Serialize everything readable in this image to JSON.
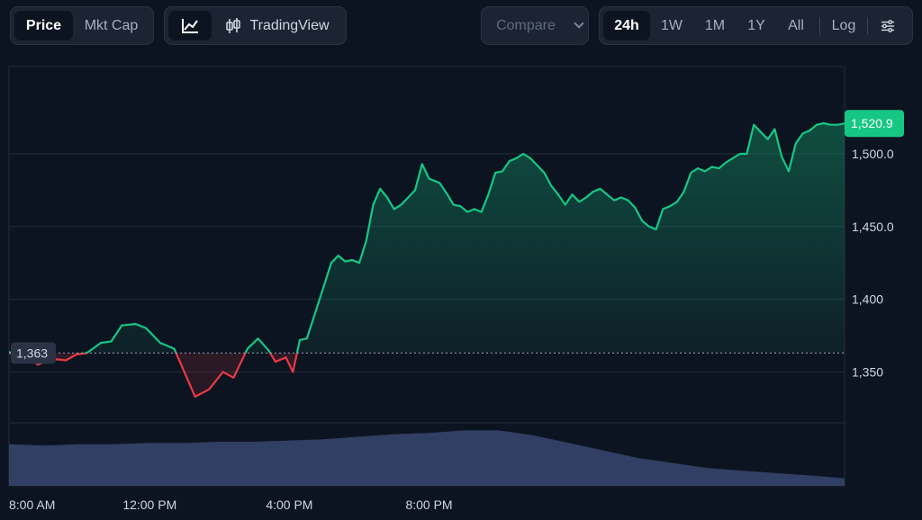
{
  "toolbar": {
    "metric_tabs": [
      "Price",
      "Mkt Cap"
    ],
    "active_metric": "Price",
    "tradingview_label": "TradingView",
    "compare_label": "Compare",
    "ranges": [
      "24h",
      "1W",
      "1M",
      "1Y",
      "All"
    ],
    "active_range": "24h",
    "log_label": "Log"
  },
  "colors": {
    "up": "#16c784",
    "down": "#ea3943",
    "volume": "#3a4670",
    "grid": "#222b3b",
    "background": "#0d1421",
    "price_badge": "#16c784"
  },
  "icons": [
    "line-chart-icon",
    "candlestick-icon",
    "chevron-down-icon",
    "settings-sliders-icon"
  ],
  "chart_data": {
    "type": "area",
    "baseline": 1363,
    "baseline_label": "1,363",
    "last_price_label": "1,520.9",
    "last_price": 1520.9,
    "ylim": [
      1315,
      1560
    ],
    "y_ticks": [
      1350,
      1400,
      1450,
      1500
    ],
    "y_tick_labels": [
      "1,350",
      "1,400",
      "1,450.0",
      "1,500.0"
    ],
    "x_tick_labels": [
      "8:00 AM",
      "12:00 PM",
      "4:00 PM",
      "8:00 PM"
    ],
    "x_tick_hours": [
      8,
      12,
      16,
      20
    ],
    "x_range_hours": [
      7.97,
      31.9
    ],
    "grid": true,
    "series": [
      {
        "x": [
          7.97,
          8.27,
          8.6,
          8.8,
          9.2,
          9.6,
          9.9,
          10.2,
          10.6,
          10.9,
          11.2,
          11.6,
          11.9,
          12.3,
          12.7,
          12.9,
          13.3,
          13.7,
          14.1,
          14.4,
          14.6,
          14.8,
          15.1,
          15.4,
          15.6,
          15.9,
          16.1,
          16.3,
          16.5,
          16.8,
          17.2,
          17.4,
          17.6,
          17.8,
          18.0,
          18.2,
          18.4,
          18.6,
          18.8,
          19.0,
          19.2,
          19.4,
          19.6,
          19.8,
          20.0,
          20.3,
          20.5,
          20.7,
          20.9,
          21.1,
          21.3,
          21.5,
          21.7,
          21.9,
          22.1,
          22.3,
          22.5,
          22.7,
          22.9,
          23.1,
          23.3,
          23.5,
          23.7,
          23.9,
          24.1,
          24.3,
          24.5,
          24.7,
          24.9,
          25.1,
          25.3,
          25.5,
          25.7,
          25.9,
          26.1,
          26.3,
          26.5,
          26.7,
          26.9,
          27.1,
          27.3,
          27.5,
          27.7,
          27.9,
          28.1,
          28.3,
          28.5,
          28.7,
          28.9,
          29.1,
          29.3,
          29.5,
          29.7,
          29.9,
          30.1,
          30.3,
          30.5,
          30.7,
          30.9,
          31.1,
          31.3,
          31.5,
          31.7,
          31.9
        ],
        "y": [
          1364,
          1357,
          1358,
          1355,
          1359,
          1358,
          1362,
          1363,
          1370,
          1371,
          1382,
          1383,
          1380,
          1370,
          1366,
          1355,
          1333,
          1338,
          1350,
          1346,
          1356,
          1366,
          1373,
          1365,
          1357,
          1360,
          1350,
          1372,
          1373,
          1395,
          1425,
          1430,
          1426,
          1427,
          1425,
          1440,
          1465,
          1476,
          1470,
          1462,
          1465,
          1470,
          1475,
          1493,
          1483,
          1480,
          1473,
          1465,
          1464,
          1460,
          1462,
          1460,
          1472,
          1487,
          1488,
          1495,
          1497,
          1500,
          1497,
          1492,
          1487,
          1478,
          1472,
          1465,
          1472,
          1467,
          1470,
          1474,
          1476,
          1472,
          1468,
          1470,
          1468,
          1463,
          1454,
          1450,
          1448,
          1462,
          1464,
          1467,
          1474,
          1487,
          1490,
          1488,
          1491,
          1490,
          1494,
          1497,
          1500,
          1500,
          1520,
          1515,
          1510,
          1517,
          1498,
          1488,
          1507,
          1514,
          1516,
          1520,
          1521,
          1520,
          1520,
          1520.9
        ]
      }
    ],
    "volume": {
      "x": [
        7.97,
        9,
        10,
        11,
        12,
        13,
        14,
        15,
        16,
        17,
        18,
        19,
        20,
        21,
        22,
        23,
        24,
        25,
        26,
        27,
        28,
        29,
        30,
        31,
        31.9
      ],
      "values": [
        33,
        32,
        33,
        33,
        34,
        34,
        35,
        35,
        36,
        37,
        39,
        41,
        42,
        44,
        44,
        40,
        34,
        28,
        22,
        18,
        14,
        12,
        10,
        8,
        6
      ]
    }
  }
}
